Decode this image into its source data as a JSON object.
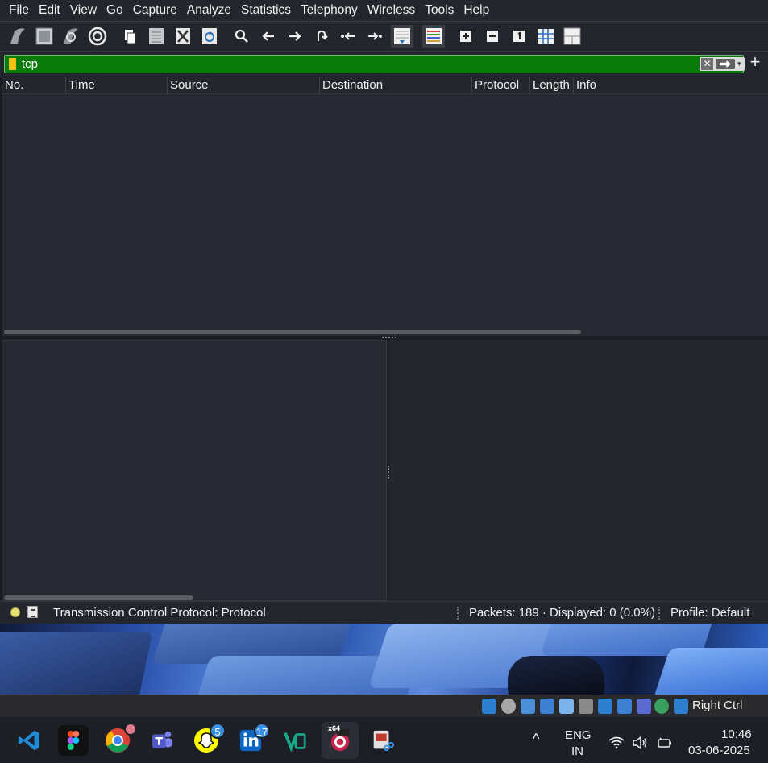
{
  "menubar": {
    "items": [
      "File",
      "Edit",
      "View",
      "Go",
      "Capture",
      "Analyze",
      "Statistics",
      "Telephony",
      "Wireless",
      "Tools",
      "Help"
    ]
  },
  "toolbar": {
    "icons": [
      "shark-fin-start-icon",
      "stop-square-icon",
      "restart-capture-icon",
      "capture-options-gear-icon",
      "open-file-icon",
      "save-file-icon",
      "close-file-icon",
      "reload-file-icon",
      "search-icon",
      "back-arrow-icon",
      "forward-arrow-icon",
      "go-to-packet-icon",
      "first-packet-icon",
      "last-packet-icon",
      "autoscroll-icon",
      "colorize-icon",
      "zoom-in-icon",
      "zoom-out-icon",
      "normal-size-icon",
      "resize-columns-icon",
      "layout-icon"
    ]
  },
  "filter": {
    "value": "tcp",
    "background_color": "#0a7b0a",
    "clear_glyph": "✕",
    "dropdown_glyph": "▾",
    "add_glyph": "+"
  },
  "packet_list": {
    "columns": [
      "No.",
      "Time",
      "Source",
      "Destination",
      "Protocol",
      "Length",
      "Info"
    ],
    "rows": []
  },
  "statusbar": {
    "message": "Transmission Control Protocol: Protocol",
    "packets": "Packets: 189 · Displayed: 0 (0.0%)",
    "profile": "Profile: Default"
  },
  "vbox": {
    "host_key": "Right Ctrl"
  },
  "taskbar": {
    "apps": [
      "Visual Studio Code",
      "Figma",
      "Google Chrome",
      "Microsoft Teams",
      "Snapchat",
      "LinkedIn",
      "Veeam",
      "VirtualBox",
      "Snipping Tool"
    ],
    "chrome_badge": "",
    "snapchat_badge": "5",
    "linkedin_badge": "17",
    "vbox_label": "x64",
    "tray_overflow_glyph": "^",
    "language_line1": "ENG",
    "language_line2": "IN",
    "time": "10:46",
    "date": "03-06-2025"
  }
}
